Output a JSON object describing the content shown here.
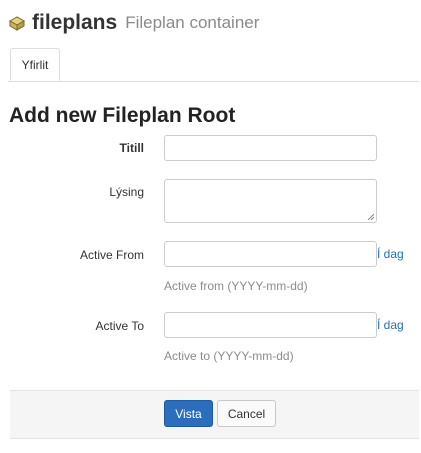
{
  "header": {
    "title": "fileplans",
    "subtitle": "Fileplan container",
    "icon": "module-icon"
  },
  "tabs": [
    {
      "label": "Yfirlit",
      "active": true
    }
  ],
  "page_title": "Add new Fileplan Root",
  "form": {
    "title_label": "Titill",
    "title_value": "",
    "description_label": "Lýsing",
    "description_value": "",
    "active_from_label": "Active From",
    "active_from_value": "",
    "active_from_today": "Í dag",
    "active_from_help": "Active from (YYYY-mm-dd)",
    "active_to_label": "Active To",
    "active_to_value": "",
    "active_to_today": "Í dag",
    "active_to_help": "Active to (YYYY-mm-dd)"
  },
  "buttons": {
    "submit": "Vista",
    "cancel": "Cancel"
  },
  "colors": {
    "primary": "#2a6ebd",
    "link": "#2a6fb0",
    "muted": "#8c8c8c"
  }
}
